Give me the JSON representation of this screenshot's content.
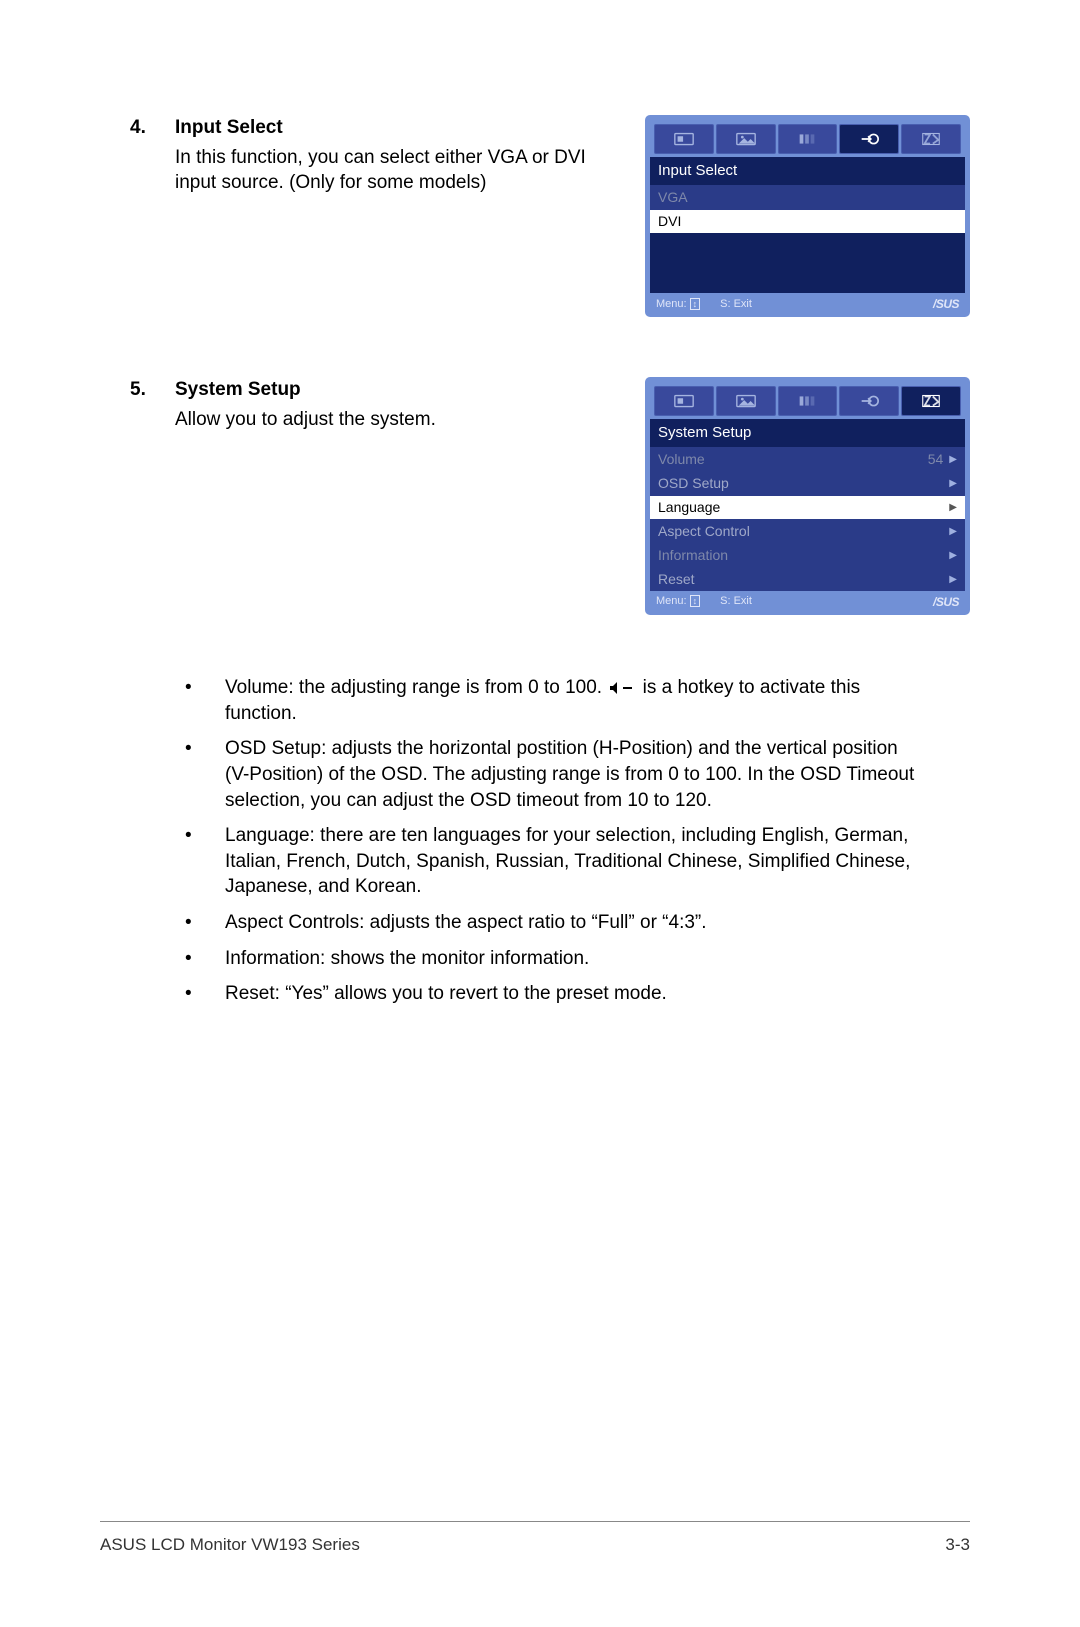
{
  "sections": [
    {
      "number": "4.",
      "title": "Input Select",
      "body": "In this function, you can select either VGA or DVI input source. (Only for some models)",
      "osd": {
        "active_tab": 3,
        "title": "Input Select",
        "items": [
          {
            "label": "VGA",
            "value": "",
            "arrow": false,
            "style": "dim"
          },
          {
            "label": "DVI",
            "value": "",
            "arrow": false,
            "style": "highlight"
          }
        ],
        "fill_height": 60,
        "footer_menu": "Menu: ",
        "footer_exit": "S: Exit",
        "brand": "/SUS"
      }
    },
    {
      "number": "5.",
      "title": "System Setup",
      "body": "Allow you to adjust the system.",
      "osd": {
        "active_tab": 4,
        "title": "System Setup",
        "items": [
          {
            "label": "Volume",
            "value": "54",
            "arrow": true,
            "style": "dim"
          },
          {
            "label": "OSD Setup",
            "value": "",
            "arrow": true,
            "style": "normal"
          },
          {
            "label": "Language",
            "value": "",
            "arrow": true,
            "style": "highlight"
          },
          {
            "label": "Aspect Control",
            "value": "",
            "arrow": true,
            "style": "normal"
          },
          {
            "label": "Information",
            "value": "",
            "arrow": true,
            "style": "dim"
          },
          {
            "label": "Reset",
            "value": "",
            "arrow": true,
            "style": "normal"
          }
        ],
        "fill_height": 0,
        "footer_menu": "Menu: ",
        "footer_exit": "S: Exit",
        "brand": "/SUS"
      }
    }
  ],
  "bullets": [
    {
      "pre": "Volume: the adjusting range is from 0 to 100. ",
      "icon": true,
      "post": " is a hotkey to activate this function."
    },
    {
      "text": "OSD Setup: adjusts the horizontal postition (H-Position) and the vertical position (V-Position) of the OSD. The adjusting range is from 0 to 100. In the OSD Timeout selection, you can adjust the OSD timeout from 10 to 120."
    },
    {
      "text": "Language: there are ten languages for your selection, including English, German, Italian, French, Dutch, Spanish, Russian, Traditional Chinese, Simplified Chinese, Japanese, and Korean."
    },
    {
      "text": "Aspect Controls: adjusts the aspect ratio to “Full” or “4:3”."
    },
    {
      "text": "Information: shows the monitor information."
    },
    {
      "text": "Reset: “Yes” allows you to revert to the preset mode."
    }
  ],
  "footer": {
    "left": "ASUS LCD Monitor VW193 Series",
    "right": "3-3"
  },
  "tab_icons": [
    "splendid",
    "image",
    "color",
    "input",
    "system"
  ]
}
